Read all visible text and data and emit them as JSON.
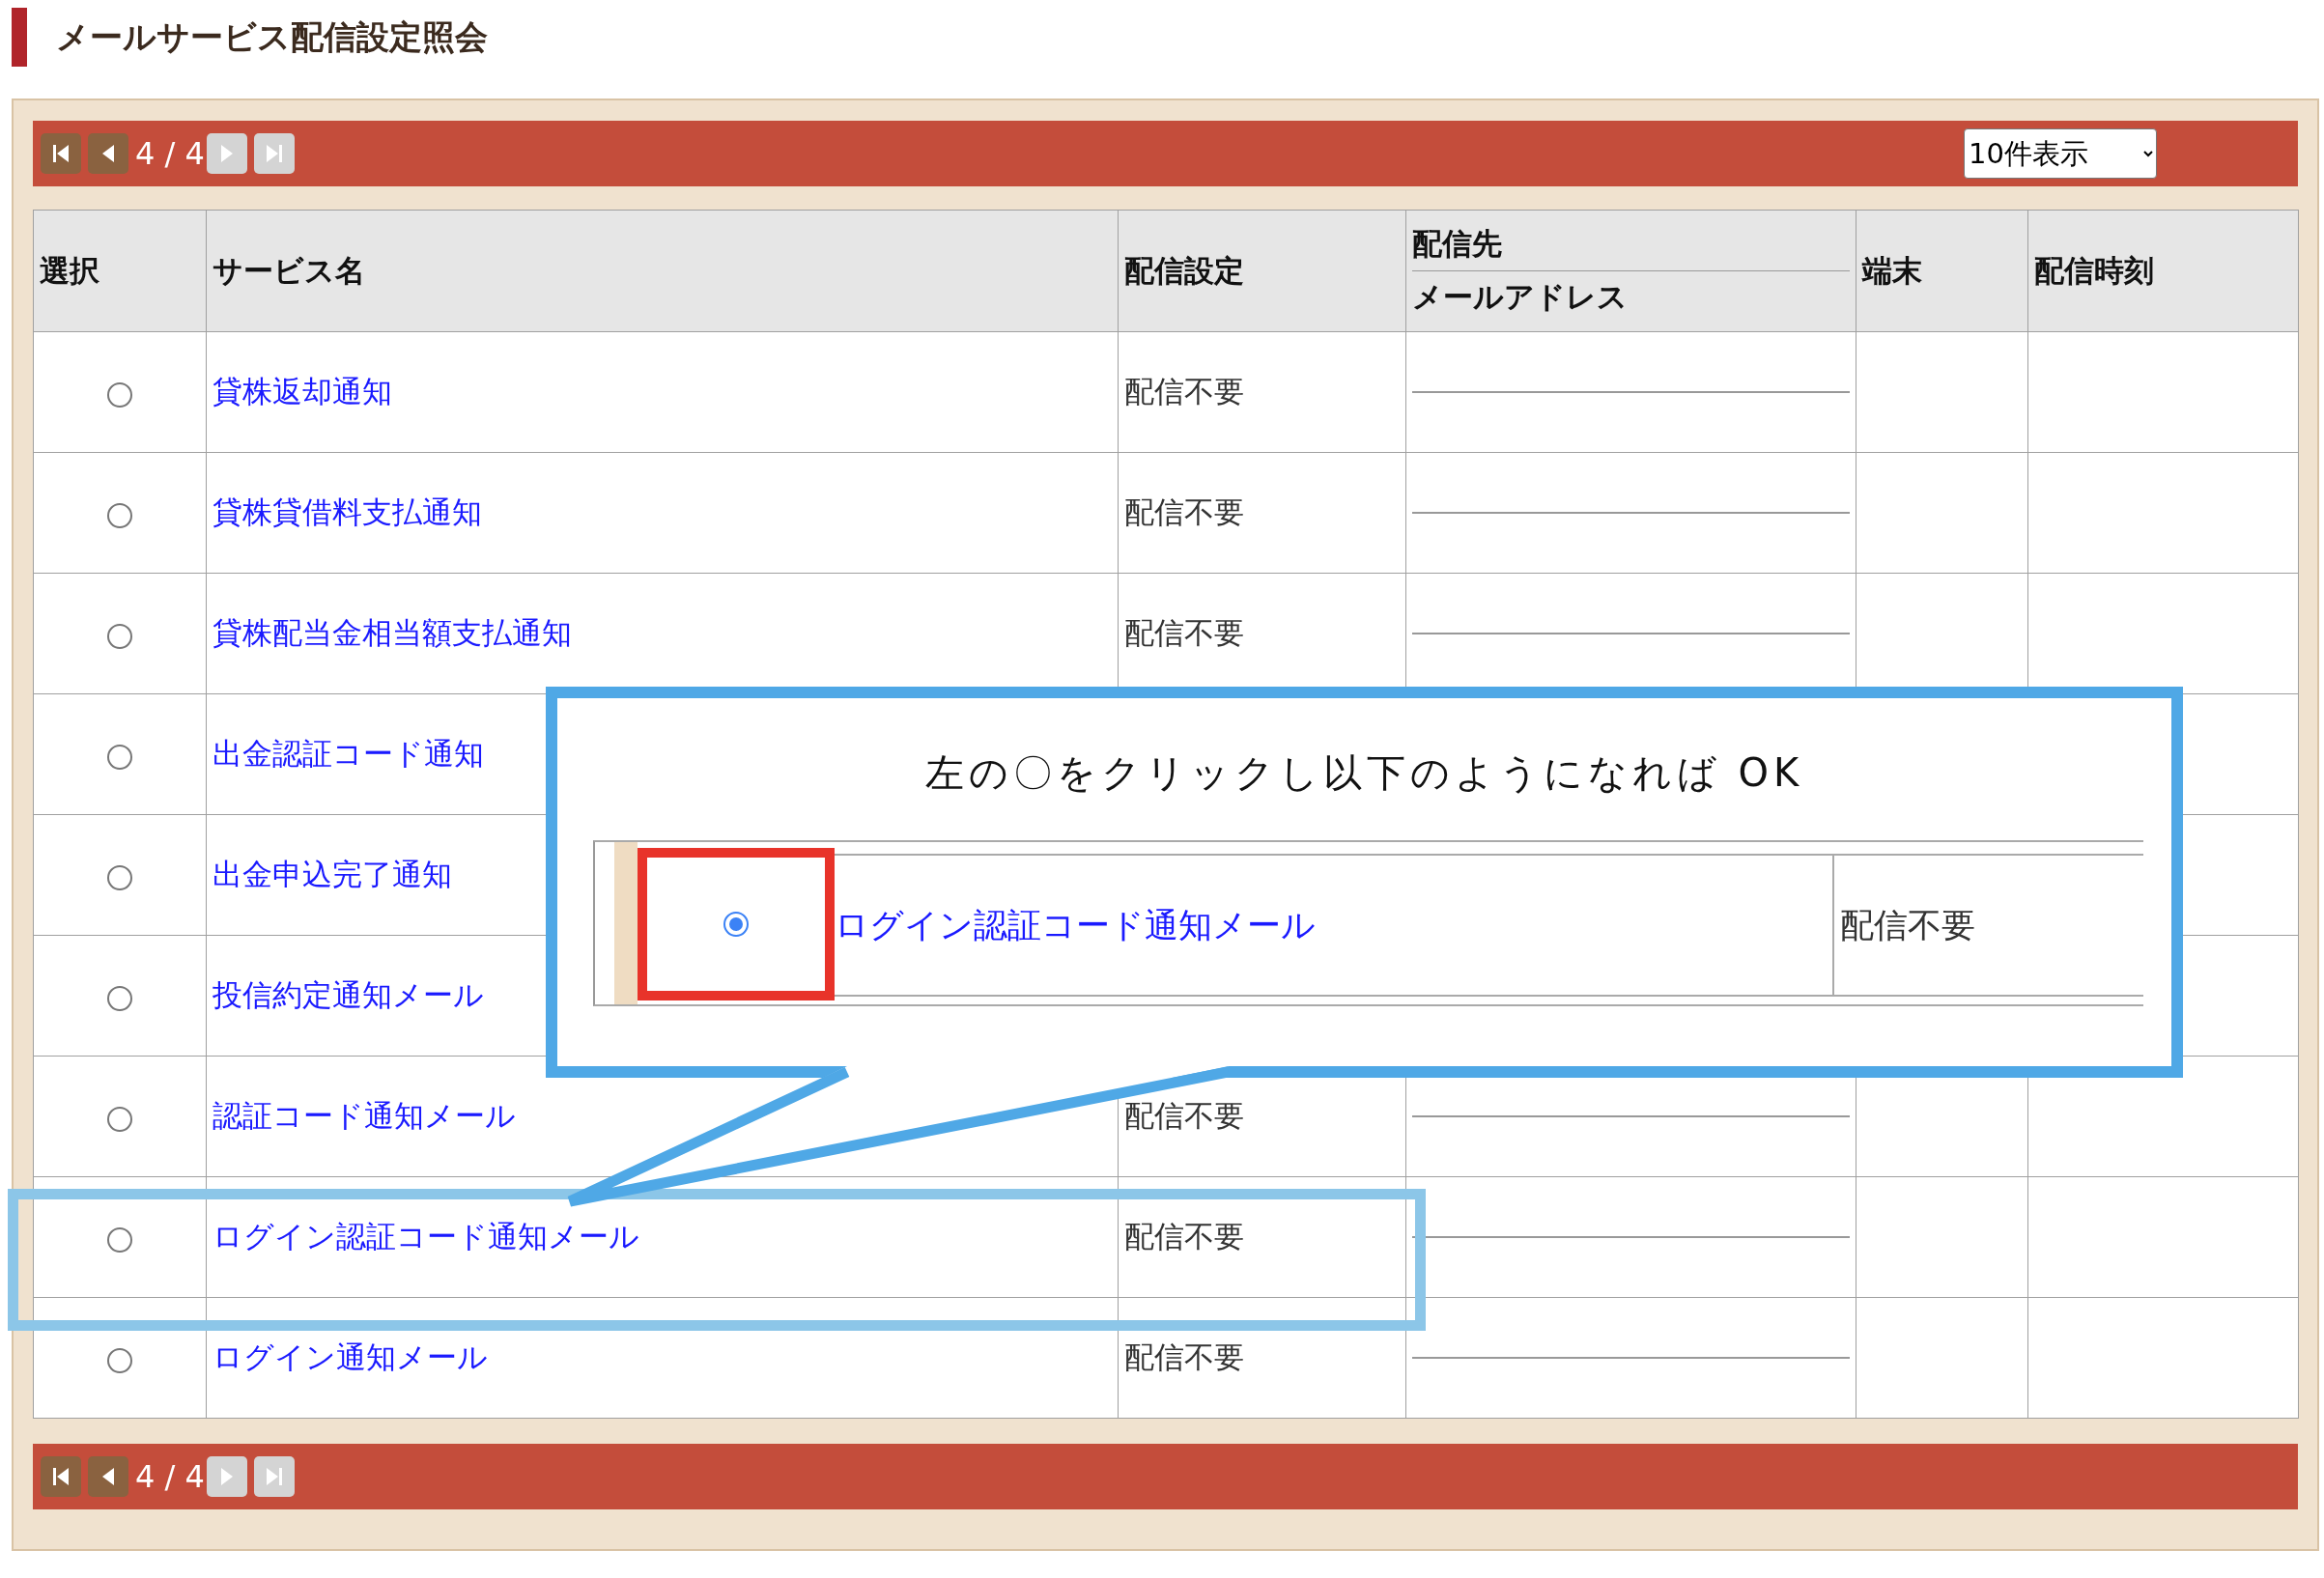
{
  "page_title": "メールサービス配信設定照会",
  "pager_top": {
    "position": "4 / 4",
    "buttons": [
      {
        "kind": "first",
        "disabled": false
      },
      {
        "kind": "prev",
        "disabled": false
      },
      {
        "kind": "next",
        "disabled": true
      },
      {
        "kind": "last",
        "disabled": true
      }
    ]
  },
  "page_size_select": {
    "value": "10件表示"
  },
  "table": {
    "columns": [
      {
        "label": "選択"
      },
      {
        "label": "サービス名"
      },
      {
        "label": "配信設定"
      },
      {
        "label": "配信先",
        "sublabel": "メールアドレス"
      },
      {
        "label": "端末"
      },
      {
        "label": "配信時刻"
      }
    ],
    "rows": [
      {
        "selected": false,
        "highlighted": false,
        "service": "貸株返却通知",
        "delivery": "配信不要"
      },
      {
        "selected": false,
        "highlighted": false,
        "service": "貸株貸借料支払通知",
        "delivery": "配信不要"
      },
      {
        "selected": false,
        "highlighted": false,
        "service": "貸株配当金相当額支払通知",
        "delivery": "配信不要"
      },
      {
        "selected": false,
        "highlighted": false,
        "service": "出金認証コード通知"
      },
      {
        "selected": false,
        "highlighted": false,
        "service": "出金申込完了通知"
      },
      {
        "selected": false,
        "highlighted": false,
        "service": "投信約定通知メール"
      },
      {
        "selected": false,
        "highlighted": false,
        "service": "認証コード通知メール",
        "delivery": "配信不要"
      },
      {
        "selected": false,
        "highlighted": true,
        "service": "ログイン認証コード通知メール",
        "delivery": "配信不要"
      },
      {
        "selected": false,
        "highlighted": false,
        "service": "ログイン通知メール",
        "delivery": "配信不要"
      }
    ]
  },
  "pager_bottom": {
    "position": "4 / 4",
    "buttons": [
      {
        "kind": "first",
        "disabled": false
      },
      {
        "kind": "prev",
        "disabled": false
      },
      {
        "kind": "next",
        "disabled": true
      },
      {
        "kind": "last",
        "disabled": true
      }
    ]
  },
  "callout": {
    "text": "左の〇をクリックし以下のようになれば OK",
    "example_row": {
      "selected": true,
      "service": "ログイン認証コード通知メール",
      "delivery": "配信不要"
    }
  }
}
